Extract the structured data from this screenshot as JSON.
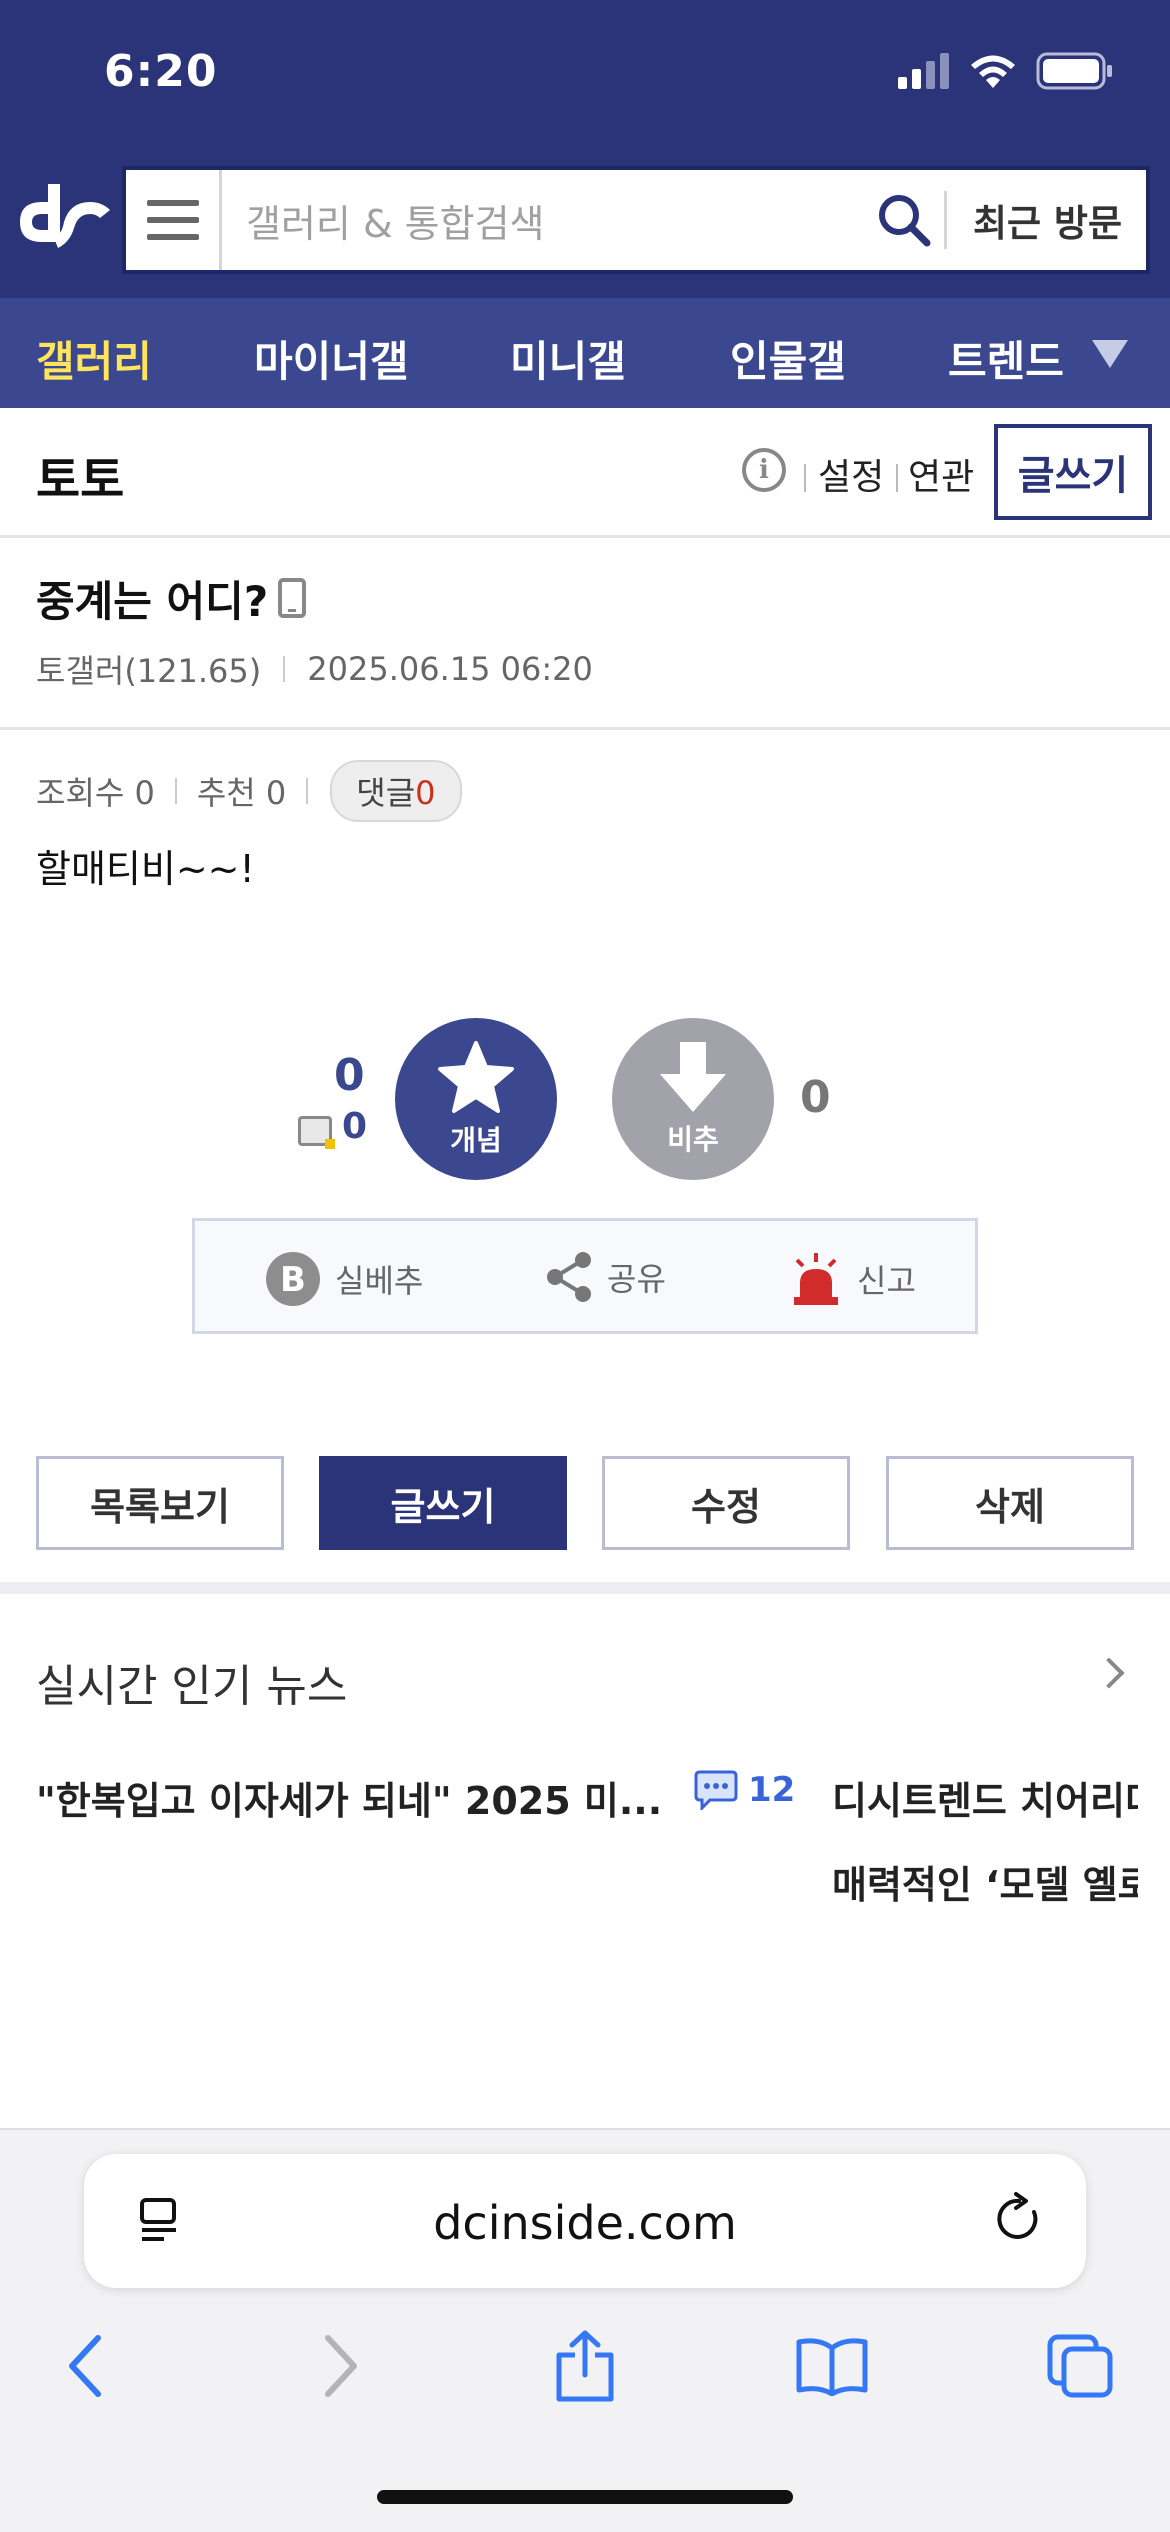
{
  "status_bar": {
    "time": "6:20"
  },
  "header": {
    "search_placeholder": "갤러리 & 통합검색",
    "recent_visit": "최근 방문"
  },
  "nav": {
    "items": [
      {
        "label": "갤러리",
        "active": true
      },
      {
        "label": "마이너갤",
        "active": false
      },
      {
        "label": "미니갤",
        "active": false
      },
      {
        "label": "인물갤",
        "active": false
      },
      {
        "label": "트렌드",
        "active": false
      }
    ]
  },
  "gallery": {
    "title": "토토",
    "links": [
      "설정",
      "연관"
    ],
    "write_label": "글쓰기"
  },
  "post": {
    "title": "중계는 어디?",
    "author": "토갤러(121.65)",
    "datetime": "2025.06.15 06:20",
    "views_label": "조회수 0",
    "recommend_label": "추천 0",
    "comment_label": "댓글",
    "comment_count": "0",
    "body": "할매티비~~!"
  },
  "vote": {
    "up_count": "0",
    "up_fixed_count": "0",
    "up_label": "개념",
    "down_label": "비추",
    "down_count": "0"
  },
  "actions": [
    {
      "label": "실베추",
      "icon": "best-b-icon"
    },
    {
      "label": "공유",
      "icon": "share-icon"
    },
    {
      "label": "신고",
      "icon": "siren-icon"
    }
  ],
  "buttons": [
    "목록보기",
    "글쓰기",
    "수정",
    "삭제"
  ],
  "news": {
    "section_title": "실시간 인기 뉴스",
    "items": [
      {
        "title": "\"한복입고 이자세가 되네\" 2025 미...",
        "comments": "12"
      },
      {
        "title": "디시트렌드 치어리더"
      },
      {
        "title": "매력적인 ‘모델 옐로"
      }
    ]
  },
  "browser": {
    "url": "dcinside.com"
  },
  "colors": {
    "brand_navy": "#2b3478",
    "nav_blue": "#3b4890",
    "active_nav": "#ffe45c",
    "alert_red": "#c8321e"
  }
}
